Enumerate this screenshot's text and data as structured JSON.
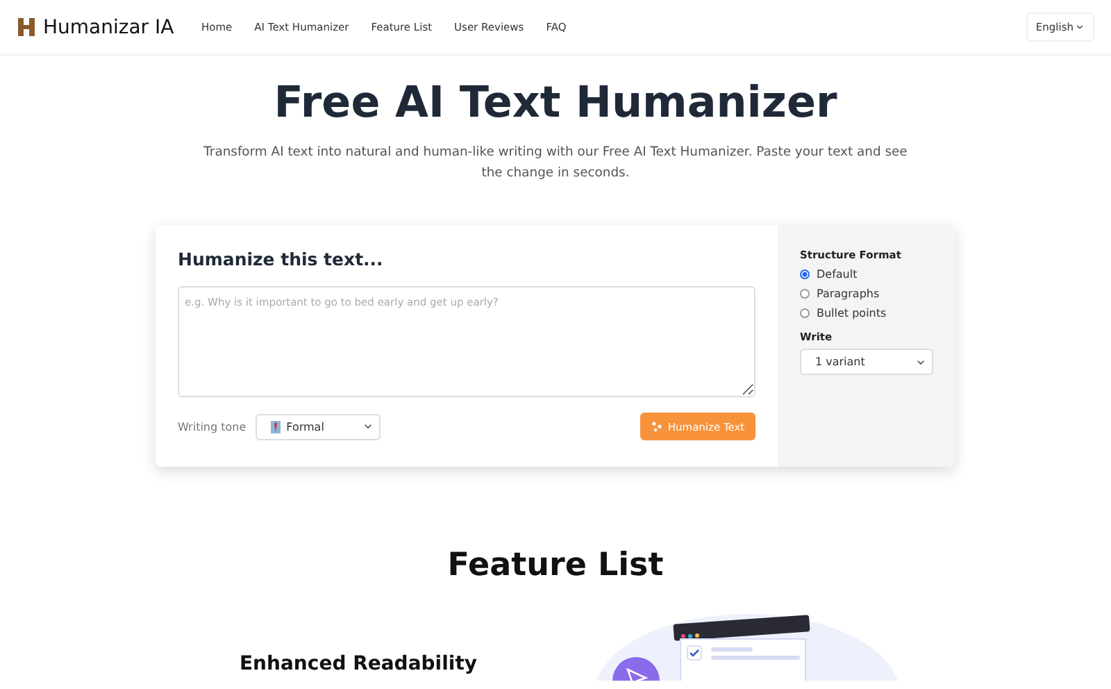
{
  "nav": {
    "brand": "Humanizar IA",
    "links": [
      {
        "label": "Home"
      },
      {
        "label": "AI Text Humanizer"
      },
      {
        "label": "Feature List"
      },
      {
        "label": "User Reviews"
      },
      {
        "label": "FAQ"
      }
    ],
    "language": "English"
  },
  "hero": {
    "title": "Free AI Text Humanizer",
    "subtitle": "Transform AI text into natural and human-like writing with our Free AI Text Humanizer. Paste your text and see the change in seconds."
  },
  "tool": {
    "heading": "Humanize this text...",
    "placeholder": "e.g. Why is it important to go to bed early and get up early?",
    "tone_label": "Writing tone",
    "tone": "Formal",
    "submit": "Humanize Text",
    "structure_label": "Structure Format",
    "formats": [
      {
        "label": "Default",
        "selected": true
      },
      {
        "label": "Paragraphs",
        "selected": false
      },
      {
        "label": "Bullet points",
        "selected": false
      }
    ],
    "write_label": "Write",
    "variants": "1 variant"
  },
  "features": {
    "heading": "Feature List",
    "first_title": "Enhanced Readability"
  }
}
